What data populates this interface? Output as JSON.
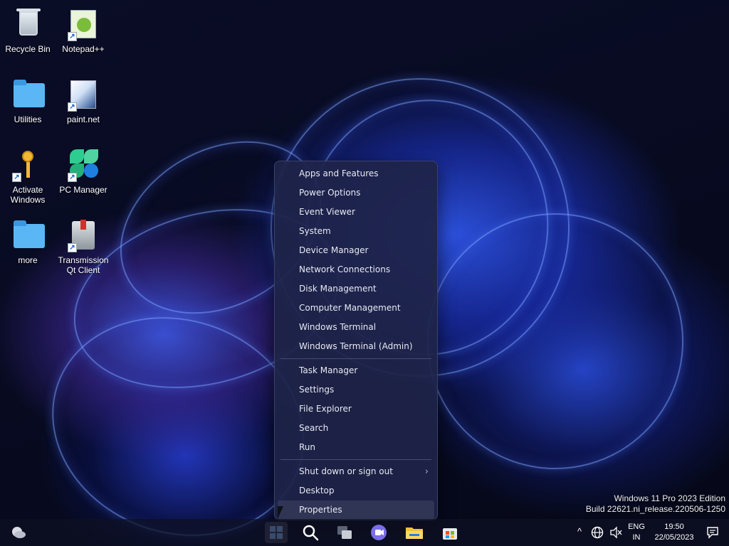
{
  "desktop": {
    "icons": [
      {
        "label": "Recycle Bin",
        "shortcut": false
      },
      {
        "label": "Notepad++",
        "shortcut": true
      },
      {
        "label": "Utilities",
        "shortcut": false
      },
      {
        "label": "paint.net",
        "shortcut": true
      },
      {
        "label": "Activate Windows",
        "shortcut": true
      },
      {
        "label": "PC Manager",
        "shortcut": true
      },
      {
        "label": "more",
        "shortcut": false
      },
      {
        "label": "Transmission Qt Client",
        "shortcut": true
      }
    ]
  },
  "context_menu": {
    "groups": [
      [
        "Apps and Features",
        "Power Options",
        "Event Viewer",
        "System",
        "Device Manager",
        "Network Connections",
        "Disk Management",
        "Computer Management",
        "Windows Terminal",
        "Windows Terminal (Admin)"
      ],
      [
        "Task Manager",
        "Settings",
        "File Explorer",
        "Search",
        "Run"
      ],
      [
        "Shut down or sign out",
        "Desktop",
        "Properties"
      ]
    ],
    "submenu_item": "Shut down or sign out",
    "highlighted_item": "Properties",
    "submenu_glyph": "›"
  },
  "watermark": {
    "line1": "Windows 11 Pro 2023 Edition",
    "line2": "Build 22621.ni_release.220506-1250"
  },
  "taskbar": {
    "left_widget_icon": "weather-cloud-icon",
    "apps": [
      "start-icon",
      "search-icon",
      "task-view-icon",
      "chat-icon",
      "file-explorer-icon",
      "store-icon"
    ],
    "tray": {
      "chevron": "^",
      "language_line1": "ENG",
      "language_line2": "IN",
      "time": "19:50",
      "date": "22/05/2023"
    }
  },
  "colors": {
    "menu_bg": "#1e2448",
    "accent": "#2b4fd8",
    "folder": "#5bb6f5"
  }
}
